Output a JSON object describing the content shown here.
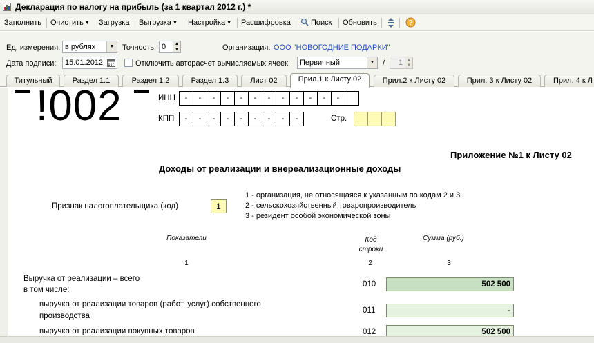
{
  "window": {
    "title": "Декларация по налогу на прибыль (за 1 квартал 2012 г.) *"
  },
  "toolbar": {
    "fill": "Заполнить",
    "clear": "Очистить",
    "load": "Загрузка",
    "unload": "Выгрузка",
    "settings": "Настройка",
    "decode": "Расшифровка",
    "search": "Поиск",
    "refresh": "Обновить"
  },
  "form": {
    "unit_label": "Ед. измерения:",
    "unit_value": "в рублях",
    "precision_label": "Точность:",
    "precision_value": "0",
    "org_label": "Организация:",
    "org_value": "ООО \"НОВОГОДНИЕ ПОДАРКИ\"",
    "sign_date_label": "Дата подписи:",
    "sign_date_value": "15.01.2012",
    "autocalc_label": "Отключить авторасчет вычисляемых ячеек",
    "doc_kind_value": "Первичный",
    "slash": "/",
    "corr_number": "1"
  },
  "tabs": [
    {
      "label": "Титульный"
    },
    {
      "label": "Раздел 1.1"
    },
    {
      "label": "Раздел 1.2"
    },
    {
      "label": "Раздел 1.3"
    },
    {
      "label": "Лист 02"
    },
    {
      "label": "Прил.1 к Листу 02"
    },
    {
      "label": "Прил.2 к Листу 02"
    },
    {
      "label": "Прил. 3 к Листу 02"
    },
    {
      "label": "Прил. 4 к Л"
    }
  ],
  "sheet": {
    "barcode": "!002",
    "inn_label": "ИНН",
    "kpp_label": "КПП",
    "page_label": "Стр.",
    "dash": "-",
    "appendix_title": "Приложение №1 к Листу 02",
    "title": "Доходы от реализации и внереализационные доходы",
    "taxpayer_sign_label": "Признак налогоплательщика (код)",
    "taxpayer_sign_value": "1",
    "code_options": [
      "1 - организация, не относящаяся к указанным по кодам 2 и 3",
      "2 - сельскохозяйственный товаропроизводитель",
      "3 - резидент особой экономической зоны"
    ],
    "col_indicators": "Показатели",
    "col_code_line1": "Код",
    "col_code_line2": "строки",
    "col_sum": "Сумма (руб.)",
    "col_num_1": "1",
    "col_num_2": "2",
    "col_num_3": "3",
    "rows": [
      {
        "label_line1": "Выручка от реализации – всего",
        "label_line2": "в том числе:",
        "code": "010",
        "value": "502 500"
      },
      {
        "label_line1": "выручка от реализации товаров (работ, услуг) собственного",
        "label_line2": "производства",
        "code": "011",
        "value": "-"
      },
      {
        "label_line1": "выручка от реализации покупных товаров",
        "label_line2": "",
        "code": "012",
        "value": "502 500"
      }
    ]
  }
}
